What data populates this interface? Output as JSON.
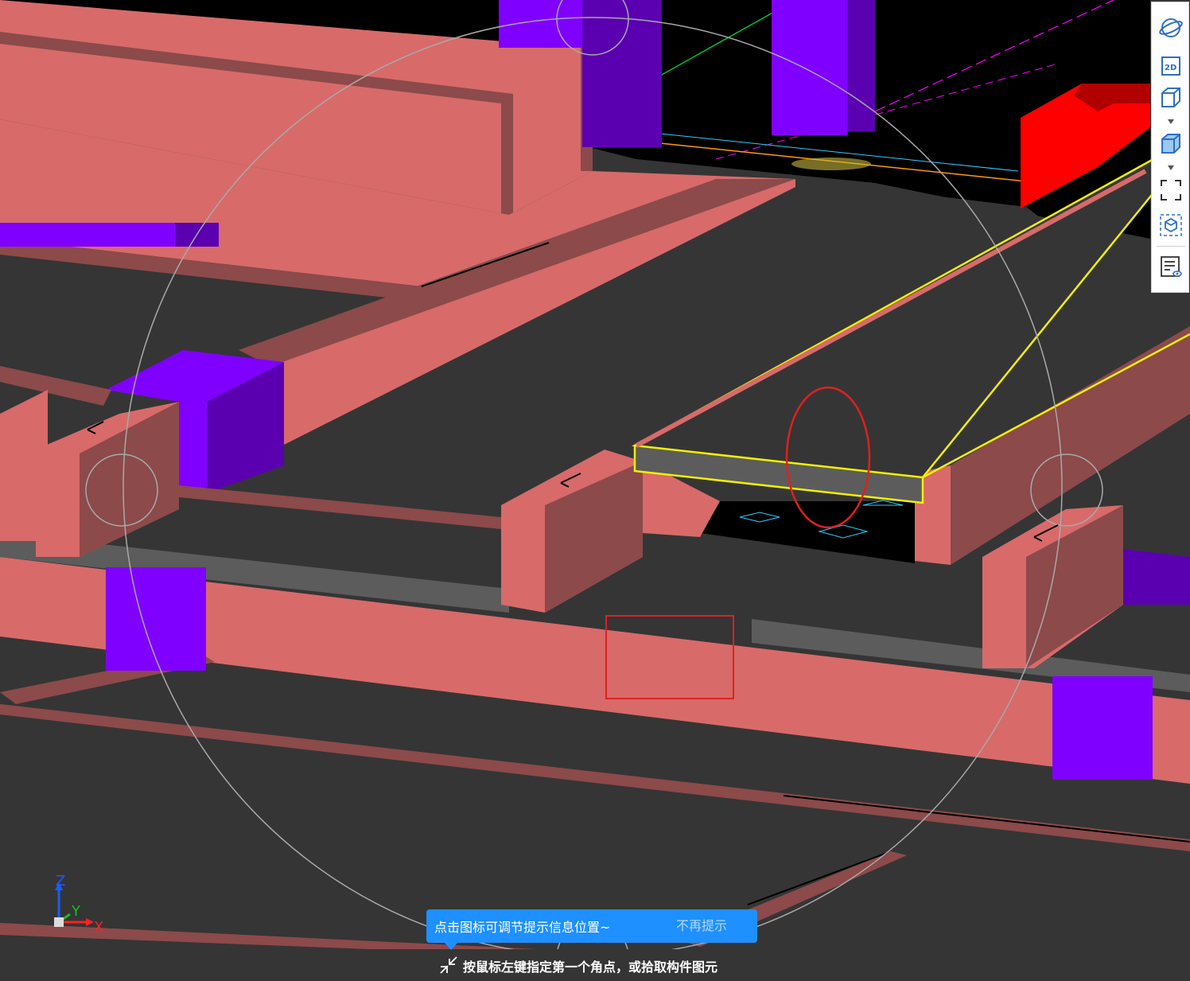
{
  "viewport": {
    "background_color": "#353535",
    "colors": {
      "beam": "#d86a6a",
      "beam_top": "#c85f5f",
      "beam_shadow": "#8c4a4a",
      "column": "#8000ff",
      "column_side": "#5a00b0",
      "slab": "#5c5c5c",
      "selected_outline": "#f2f000",
      "highlight_red": "#ff0000",
      "markup_red": "#e02020"
    },
    "axis": {
      "z_label": "Z",
      "y_label": "Y",
      "x_label": "X"
    }
  },
  "toolbar": {
    "items": [
      {
        "name": "dynamic-observe",
        "icon": "orbit-icon"
      },
      {
        "name": "view-2d",
        "icon": "2d-view-icon",
        "label": "2D"
      },
      {
        "name": "view-3d",
        "icon": "cube-outline-icon",
        "has_dropdown": true
      },
      {
        "name": "render-mode",
        "icon": "cube-solid-icon",
        "has_dropdown": true
      },
      {
        "name": "full-screen",
        "icon": "fullscreen-icon"
      },
      {
        "name": "isolate",
        "icon": "dashed-cube-icon"
      },
      {
        "name": "display-settings",
        "icon": "list-eye-icon"
      }
    ]
  },
  "tip": {
    "text": "点击图标可调节提示信息位置~",
    "dismiss": "不再提示"
  },
  "status": {
    "icon": "pick-corner-icon",
    "text": "按鼠标左键指定第一个角点，或拾取构件图元"
  }
}
